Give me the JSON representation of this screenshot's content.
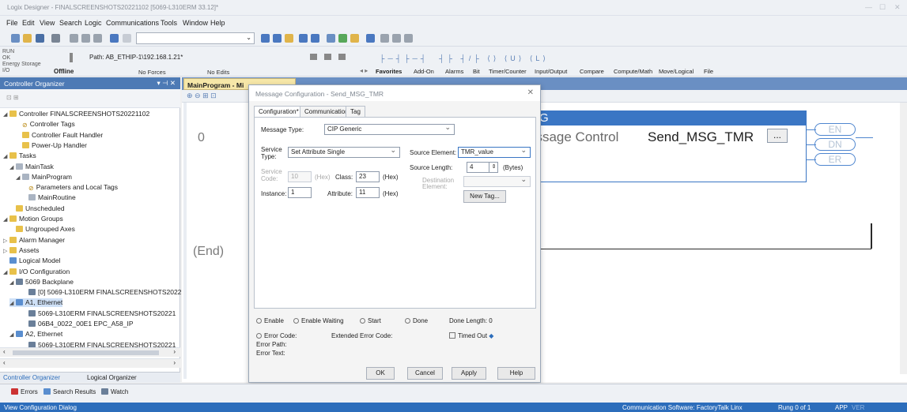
{
  "window": {
    "title": "Logix Designer - FINALSCREENSHOTS20221102 [5069-L310ERM 33.12]*"
  },
  "menu": [
    "File",
    "Edit",
    "View",
    "Search",
    "Logic",
    "Communications",
    "Tools",
    "Window",
    "Help"
  ],
  "status_panel": {
    "run": "RUN",
    "ok": "OK",
    "energy": "Energy Storage",
    "io": "I/O",
    "path_label": "Path: AB_ETHIP-1\\192.168.1.21*",
    "mode": "Offline",
    "forces": "No Forces",
    "edits": "No Edits"
  },
  "instruction_tabs": [
    "Favorites",
    "Add-On",
    "Alarms",
    "Bit",
    "Timer/Counter",
    "Input/Output",
    "Compare",
    "Compute/Math",
    "Move/Logical",
    "File"
  ],
  "ladder_palette": [
    "┤├",
    "┤/├",
    "-( )-",
    "-(U)-",
    "-(L)-"
  ],
  "organizer": {
    "title": "Controller Organizer",
    "items": [
      {
        "label": "Controller FINALSCREENSHOTS20221102",
        "icon": "folder",
        "indent": 0,
        "exp": "◢"
      },
      {
        "label": "Controller Tags",
        "icon": "tag",
        "indent": 2,
        "exp": ""
      },
      {
        "label": "Controller Fault Handler",
        "icon": "folder",
        "indent": 2,
        "exp": ""
      },
      {
        "label": "Power-Up Handler",
        "icon": "folder",
        "indent": 2,
        "exp": ""
      },
      {
        "label": "Tasks",
        "icon": "folder",
        "indent": 0,
        "exp": "◢"
      },
      {
        "label": "MainTask",
        "icon": "gray",
        "indent": 1,
        "exp": "◢"
      },
      {
        "label": "MainProgram",
        "icon": "gray",
        "indent": 2,
        "exp": "◢"
      },
      {
        "label": "Parameters and Local Tags",
        "icon": "tag",
        "indent": 3,
        "exp": ""
      },
      {
        "label": "MainRoutine",
        "icon": "gray",
        "indent": 3,
        "exp": ""
      },
      {
        "label": "Unscheduled",
        "icon": "folder",
        "indent": 1,
        "exp": ""
      },
      {
        "label": "Motion Groups",
        "icon": "folder",
        "indent": 0,
        "exp": "◢"
      },
      {
        "label": "Ungrouped Axes",
        "icon": "folder",
        "indent": 1,
        "exp": ""
      },
      {
        "label": "Alarm Manager",
        "icon": "folder",
        "indent": 0,
        "exp": "▷"
      },
      {
        "label": "Assets",
        "icon": "folder",
        "indent": 0,
        "exp": "▷"
      },
      {
        "label": "Logical Model",
        "icon": "net",
        "indent": 0,
        "exp": ""
      },
      {
        "label": "I/O Configuration",
        "icon": "folder",
        "indent": 0,
        "exp": "◢"
      },
      {
        "label": "5069 Backplane",
        "icon": "dev",
        "indent": 1,
        "exp": "◢"
      },
      {
        "label": "[0] 5069-L310ERM FINALSCREENSHOTS2022",
        "icon": "dev",
        "indent": 3,
        "exp": ""
      },
      {
        "label": "A1, Ethernet",
        "icon": "net",
        "indent": 1,
        "exp": "◢"
      },
      {
        "label": "5069-L310ERM FINALSCREENSHOTS20221",
        "icon": "dev",
        "indent": 3,
        "exp": ""
      },
      {
        "label": "06B4_0022_00E1 EPC_A58_IP",
        "icon": "dev",
        "indent": 3,
        "exp": ""
      },
      {
        "label": "A2, Ethernet",
        "icon": "net",
        "indent": 1,
        "exp": "◢"
      },
      {
        "label": "5069-L310ERM FINALSCREENSHOTS20221",
        "icon": "dev",
        "indent": 3,
        "exp": ""
      }
    ],
    "tabs": [
      "Controller Organizer",
      "Logical Organizer"
    ]
  },
  "editor": {
    "tab_label": "MainProgram - Mi",
    "rung0": "0",
    "end": "(End)",
    "msg_block": {
      "header": "SG",
      "control_label": "essage Control",
      "control_tag": "Send_MSG_TMR",
      "browse": "...",
      "coils": [
        "EN",
        "DN",
        "ER"
      ]
    }
  },
  "dialog": {
    "title": "Message Configuration - Send_MSG_TMR",
    "tabs": [
      "Configuration*",
      "Communication",
      "Tag"
    ],
    "message_type_label": "Message Type:",
    "message_type_value": "CIP Generic",
    "service_type_label": "Service Type:",
    "service_type_value": "Set Attribute Single",
    "service_code_label": "Service Code:",
    "service_code_value": "10",
    "hex1": "(Hex)",
    "class_label": "Class:",
    "class_value": "23",
    "hex2": "(Hex)",
    "instance_label": "Instance:",
    "instance_value": "1",
    "attribute_label": "Attribute:",
    "attribute_value": "11",
    "hex3": "(Hex)",
    "source_element_label": "Source Element:",
    "source_element_value": "TMR_value",
    "source_length_label": "Source Length:",
    "source_length_value": "4",
    "bytes": "(Bytes)",
    "destination_label": "Destination Element:",
    "new_tag": "New Tag...",
    "status": {
      "enable": "Enable",
      "enable_waiting": "Enable Waiting",
      "start": "Start",
      "done": "Done",
      "done_length": "Done Length: 0",
      "error_code": "Error Code:",
      "extended_error": "Extended Error Code:",
      "timed_out": "Timed Out",
      "error_path": "Error Path:",
      "error_text": "Error Text:"
    },
    "buttons": {
      "ok": "OK",
      "cancel": "Cancel",
      "apply": "Apply",
      "help": "Help"
    }
  },
  "bottom_tabs": [
    "Errors",
    "Search Results",
    "Watch"
  ],
  "statusbar": {
    "left": "View Configuration Dialog",
    "comm": "Communication Software: FactoryTalk Linx",
    "rung": "Rung 0 of 1",
    "app": "APP",
    "ver": "VER"
  }
}
